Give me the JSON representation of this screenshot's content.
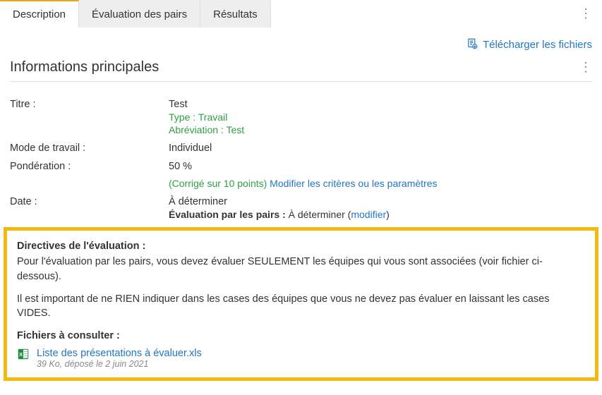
{
  "tabs": {
    "description": "Description",
    "peer_eval": "Évaluation des pairs",
    "results": "Résultats"
  },
  "download_files_label": "Télécharger les fichiers",
  "section_title": "Informations principales",
  "fields": {
    "title_label": "Titre :",
    "title_value": "Test",
    "type_line": "Type : Travail",
    "abbrev_line": "Abréviation : Test",
    "work_mode_label": "Mode de travail :",
    "work_mode_value": "Individuel",
    "weight_label": "Pondération :",
    "weight_value": "50 %",
    "corrected_line": "(Corrigé sur 10 points)",
    "modify_criteria_link": "Modifier les critères ou les paramètres",
    "date_label": "Date :",
    "date_value": "À déterminer",
    "peer_eval_bold": "Évaluation par les pairs :",
    "peer_eval_value": "À déterminer",
    "modify_link": "modifier"
  },
  "directives": {
    "heading": "Directives de l'évaluation :",
    "p1": "Pour l'évaluation par les pairs, vous devez évaluer SEULEMENT les équipes qui vous sont associées (voir fichier ci-dessous).",
    "p2": "Il est important de ne RIEN indiquer dans les cases des équipes que vous ne devez pas évaluer en laissant les cases VIDES.",
    "files_heading": "Fichiers à consulter :",
    "file_name": "Liste des présentations à évaluer.xls",
    "file_meta": "39 Ko, déposé le 2 juin 2021"
  }
}
